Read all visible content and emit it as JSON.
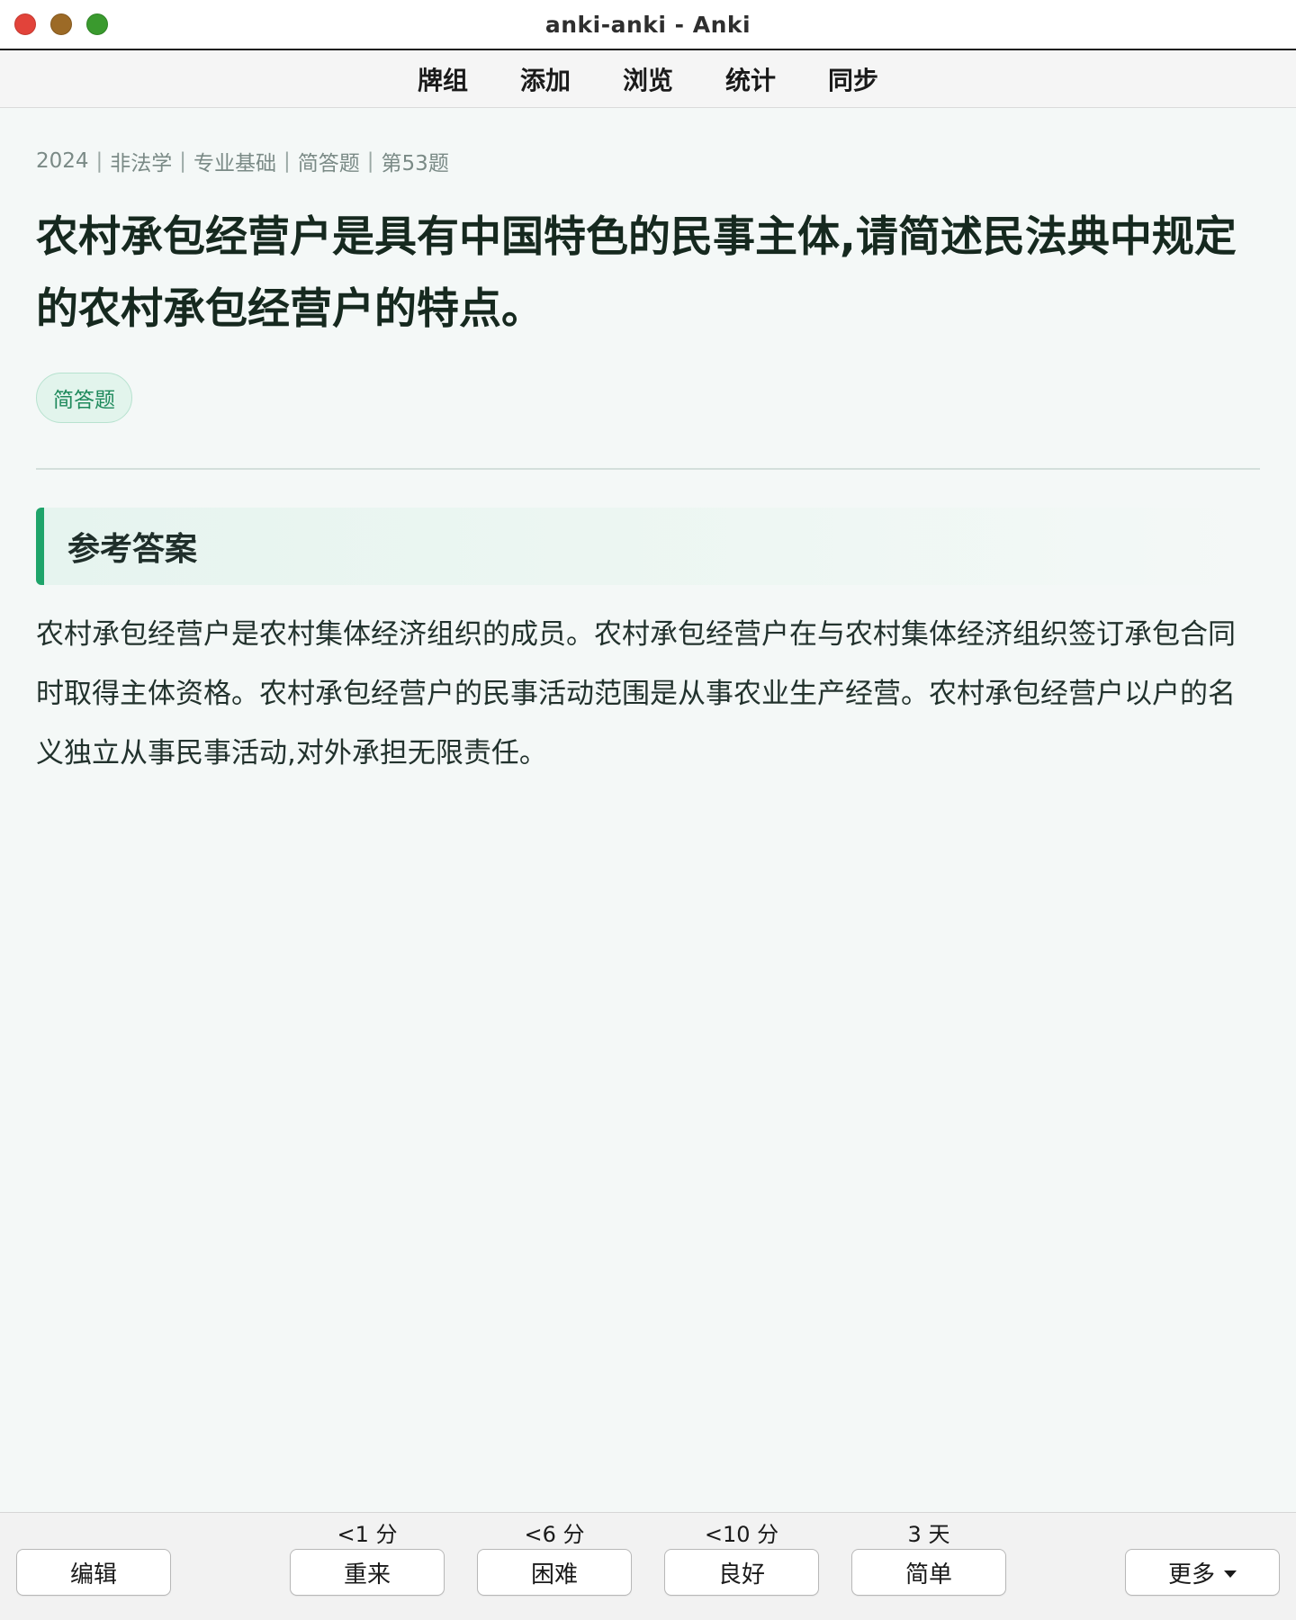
{
  "window": {
    "title": "anki-anki - Anki"
  },
  "toolbar": {
    "items": [
      "牌组",
      "添加",
      "浏览",
      "统计",
      "同步"
    ]
  },
  "card": {
    "breadcrumb": [
      "2024",
      "非法学",
      "专业基础",
      "简答题",
      "第53题"
    ],
    "question": "农村承包经营户是具有中国特色的民事主体,请简述民法典中规定的农村承包经营户的特点。",
    "tag": "简答题",
    "answer_heading": "参考答案",
    "answer_text": "农村承包经营户是农村集体经济组织的成员。农村承包经营户在与农村集体经济组织签订承包合同时取得主体资格。农村承包经营户的民事活动范围是从事农业生产经营。农村承包经营户以户的名义独立从事民事活动,对外承担无限责任。"
  },
  "bottombar": {
    "edit_label": "编辑",
    "more_label": "更多",
    "answers": [
      {
        "label": "重来",
        "interval": "<1 分"
      },
      {
        "label": "困难",
        "interval": "<6 分"
      },
      {
        "label": "良好",
        "interval": "<10 分"
      },
      {
        "label": "简单",
        "interval": "3 天"
      }
    ]
  },
  "colors": {
    "accent": "#1ea46a",
    "tag_text": "#1f8a5c",
    "tag_bg": "#e2f4ec",
    "background": "#f4f8f7"
  }
}
